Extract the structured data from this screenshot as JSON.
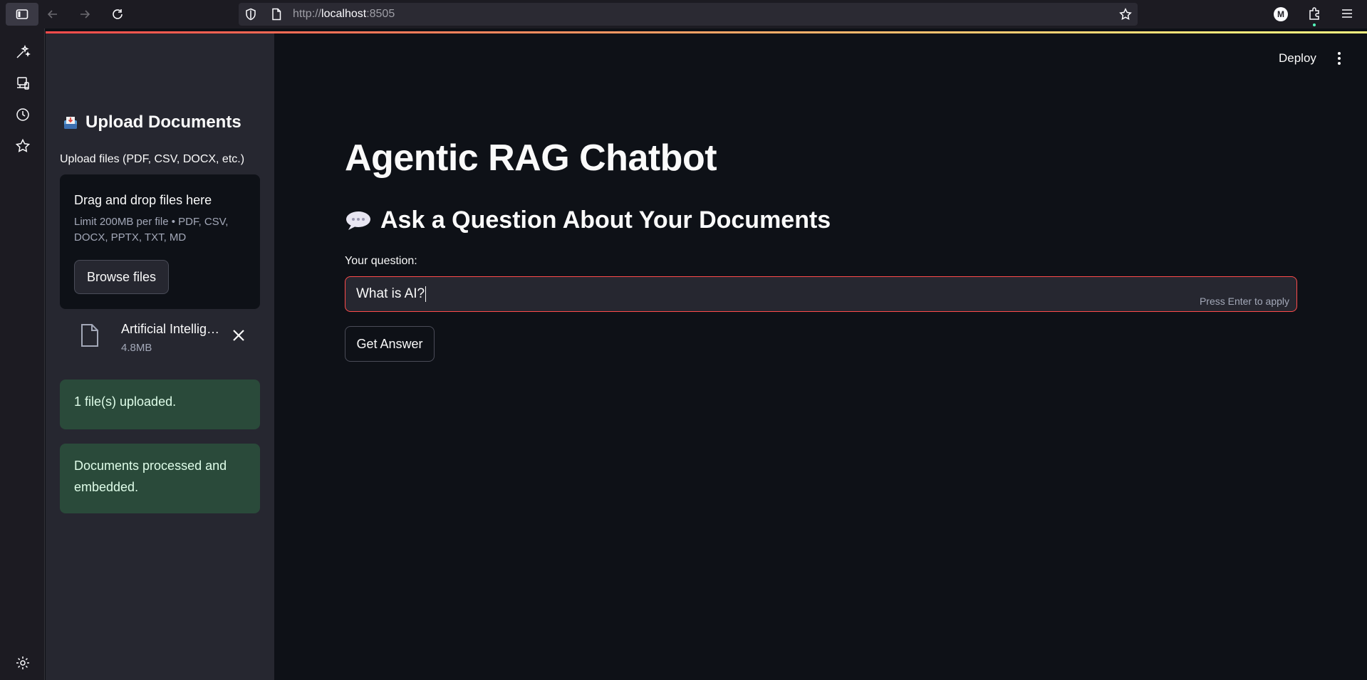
{
  "browser": {
    "url_prefix": "http://",
    "url_host": "localhost",
    "url_port": ":8505",
    "account_initial": "M"
  },
  "ff_sidebar": {
    "icons": [
      "ai-sparkle-icon",
      "synced-tabs-icon",
      "history-icon",
      "bookmarks-icon",
      "settings-icon"
    ]
  },
  "sidebar": {
    "title": "Upload Documents",
    "uploader_label": "Upload files (PDF, CSV, DOCX, etc.)",
    "dropzone_title": "Drag and drop files here",
    "dropzone_limit": "Limit 200MB per file • PDF, CSV, DOCX, PPTX, TXT, MD",
    "browse_label": "Browse files",
    "file": {
      "name": "Artificial Intelligence",
      "size": "4.8MB"
    },
    "alerts": [
      "1 file(s) uploaded.",
      "Documents processed and embedded."
    ]
  },
  "header": {
    "deploy_label": "Deploy"
  },
  "main": {
    "title": "Agentic RAG Chatbot",
    "subtitle": "Ask a Question About Your Documents",
    "question_label": "Your question:",
    "question_value": "What is AI?",
    "input_hint": "Press Enter to apply",
    "button_label": "Get Answer"
  },
  "colors": {
    "background": "#0e1117",
    "sidebar": "#262730",
    "accent": "#ff4b4b",
    "success_bg": "#2a4a3a"
  }
}
